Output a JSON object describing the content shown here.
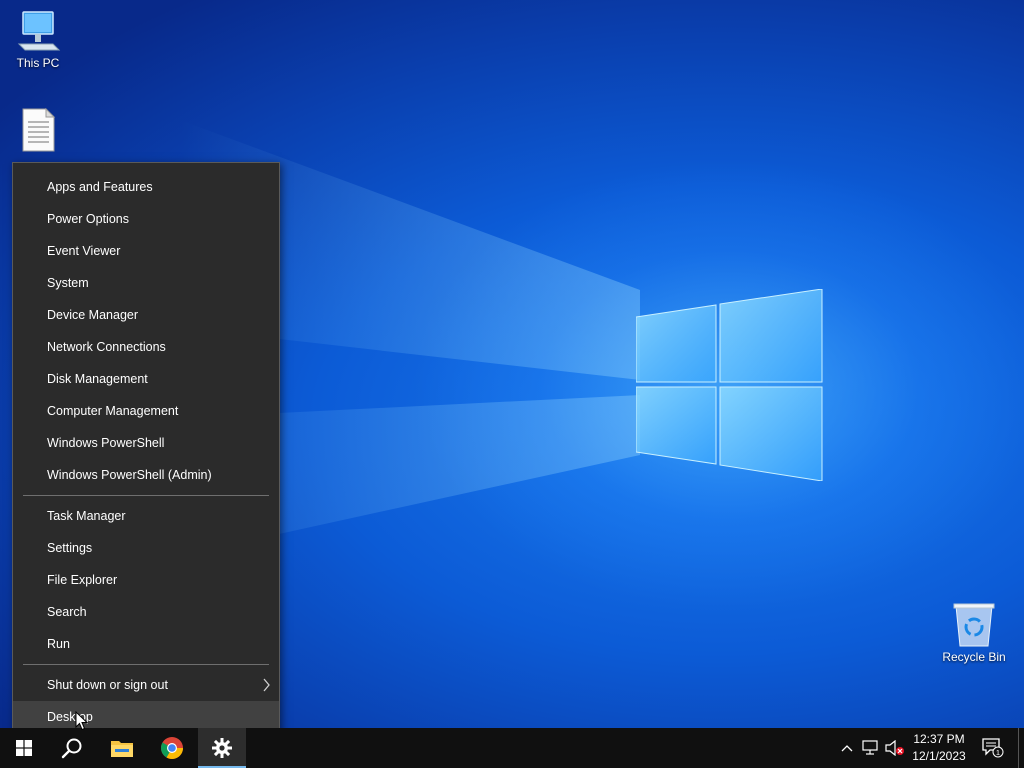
{
  "desktop": {
    "icons": [
      {
        "label": "This PC",
        "icon": "computer-icon"
      },
      {
        "label": "",
        "icon": "text-document-icon"
      },
      {
        "label": "Recycle Bin",
        "icon": "recycle-bin-icon"
      }
    ]
  },
  "context_menu": {
    "group1": [
      "Apps and Features",
      "Power Options",
      "Event Viewer",
      "System",
      "Device Manager",
      "Network Connections",
      "Disk Management",
      "Computer Management",
      "Windows PowerShell",
      "Windows PowerShell (Admin)"
    ],
    "group2": [
      "Task Manager",
      "Settings",
      "File Explorer",
      "Search",
      "Run"
    ],
    "group3": [
      "Shut down or sign out",
      "Desktop"
    ],
    "hovered_item": "Desktop"
  },
  "taskbar": {
    "apps": [
      {
        "name": "start",
        "icon": "windows-start-icon"
      },
      {
        "name": "search",
        "icon": "search-icon"
      },
      {
        "name": "file-explorer",
        "icon": "folder-icon"
      },
      {
        "name": "chrome",
        "icon": "chrome-icon"
      },
      {
        "name": "settings",
        "icon": "gear-icon",
        "active": true
      }
    ],
    "clock": {
      "time": "12:37 PM",
      "date": "12/1/2023"
    },
    "notification_count": "1",
    "accent_color": "#76b9ed"
  }
}
